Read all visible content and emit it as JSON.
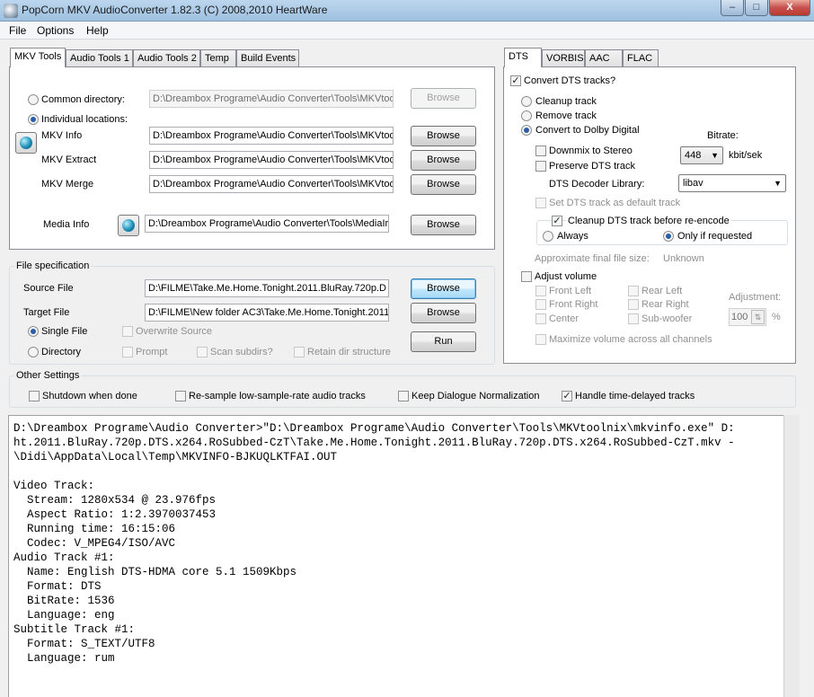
{
  "window": {
    "title": "PopCorn MKV AudioConverter 1.82.3 (C) 2008,2010 HeartWare",
    "minimize": "–",
    "maximize": "□",
    "close": "X"
  },
  "menu": [
    "File",
    "Options",
    "Help"
  ],
  "left_tabs": [
    "MKV Tools",
    "Audio Tools 1",
    "Audio Tools 2",
    "Temp",
    "Build Events"
  ],
  "mkv_tools": {
    "common_directory_label": "Common directory:",
    "common_directory_value": "D:\\Dreambox Programe\\Audio Converter\\Tools\\MKVtoo",
    "individual_locations_label": "Individual locations:",
    "mkv_info_label": "MKV Info",
    "mkv_info_value": "D:\\Dreambox Programe\\Audio Converter\\Tools\\MKVtoo",
    "mkv_extract_label": "MKV Extract",
    "mkv_extract_value": "D:\\Dreambox Programe\\Audio Converter\\Tools\\MKVtoo",
    "mkv_merge_label": "MKV Merge",
    "mkv_merge_value": "D:\\Dreambox Programe\\Audio Converter\\Tools\\MKVtoo",
    "media_info_label": "Media Info",
    "media_info_value": "D:\\Dreambox Programe\\Audio Converter\\Tools\\MediaIr",
    "browse_label": "Browse"
  },
  "file_spec": {
    "title": "File specification",
    "source_label": "Source File",
    "source_value": "D:\\FILME\\Take.Me.Home.Tonight.2011.BluRay.720p.D",
    "target_label": "Target File",
    "target_value": "D:\\FILME\\New folder AC3\\Take.Me.Home.Tonight.2011",
    "browse_label": "Browse",
    "run_label": "Run",
    "single_file": "Single File",
    "directory": "Directory",
    "overwrite_source": "Overwrite Source",
    "prompt": "Prompt",
    "scan_subdirs": "Scan subdirs?",
    "retain_dir": "Retain dir structure"
  },
  "other_settings": {
    "title": "Other Settings",
    "shutdown": "Shutdown when done",
    "resample": "Re-sample low-sample-rate audio tracks",
    "keep_dialogue": "Keep Dialogue Normalization",
    "handle_delayed": "Handle time-delayed tracks",
    "handle_delayed_checked": true
  },
  "right_tabs": [
    "DTS",
    "VORBIS",
    "AAC",
    "FLAC"
  ],
  "dts": {
    "convert_label": "Convert DTS tracks?",
    "convert_checked": true,
    "cleanup_track": "Cleanup track",
    "remove_track": "Remove track",
    "convert_dolby": "Convert to Dolby Digital",
    "selected_action": "Convert to Dolby Digital",
    "bitrate_label": "Bitrate:",
    "bitrate_value": "448",
    "bitrate_unit": "kbit/sek",
    "downmix": "Downmix to Stereo",
    "preserve": "Preserve DTS track",
    "decoder_label": "DTS Decoder Library:",
    "decoder_value": "libav",
    "set_default": "Set DTS track as default track",
    "cleanup_before": "Cleanup DTS track before re-encode",
    "cleanup_before_checked": true,
    "always": "Always",
    "only_if_requested": "Only if requested",
    "selected_cleanup_mode": "Only if requested",
    "approx_label": "Approximate final file size:",
    "approx_value": "Unknown",
    "adjust_volume": "Adjust volume",
    "front_left": "Front Left",
    "front_right": "Front Right",
    "center": "Center",
    "rear_left": "Rear Left",
    "rear_right": "Rear Right",
    "sub_woofer": "Sub-woofer",
    "adjustment_label": "Adjustment:",
    "adjustment_value": "100",
    "adjustment_unit": "%",
    "maximize": "Maximize volume across all channels"
  },
  "log": {
    "lines": [
      "D:\\Dreambox Programe\\Audio Converter>\"D:\\Dreambox Programe\\Audio Converter\\Tools\\MKVtoolnix\\mkvinfo.exe\" D:",
      "ht.2011.BluRay.720p.DTS.x264.RoSubbed-CzT\\Take.Me.Home.Tonight.2011.BluRay.720p.DTS.x264.RoSubbed-CzT.mkv -",
      "\\Didi\\AppData\\Local\\Temp\\MKVINFO-BJKUQLKTFAI.OUT",
      "",
      "Video Track:",
      "  Stream: 1280x534 @ 23.976fps",
      "  Aspect Ratio: 1:2.3970037453",
      "  Running time: 16:15:06",
      "  Codec: V_MPEG4/ISO/AVC",
      "Audio Track #1:",
      "  Name: English DTS-HDMA core 5.1 1509Kbps",
      "  Format: DTS",
      "  BitRate: 1536",
      "  Language: eng",
      "Subtitle Track #1:",
      "  Format: S_TEXT/UTF8",
      "  Language: rum"
    ]
  }
}
